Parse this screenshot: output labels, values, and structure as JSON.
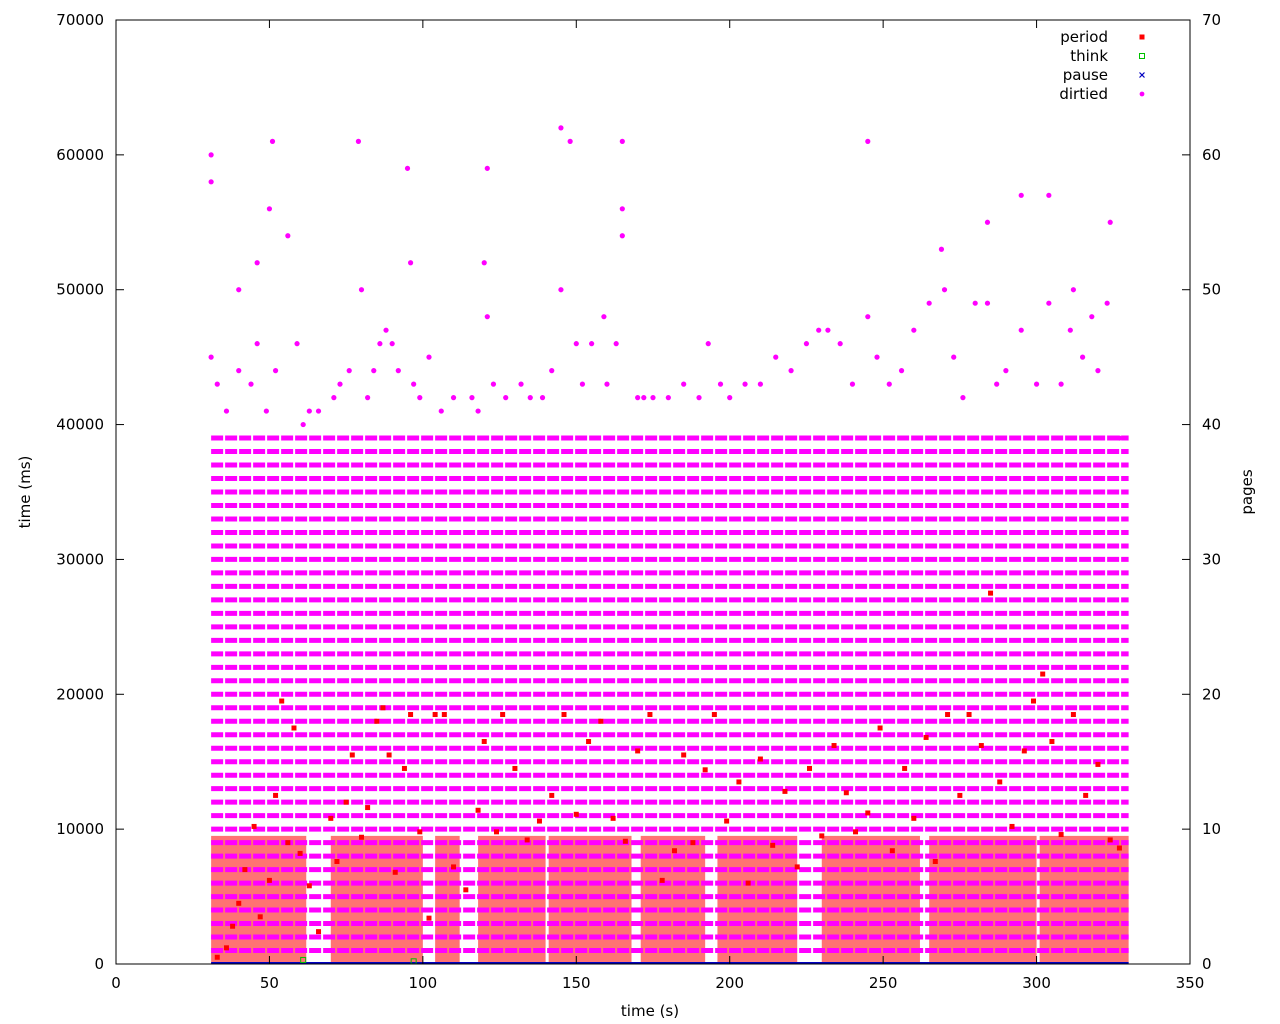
{
  "chart_data": {
    "type": "scatter",
    "title": "",
    "xlabel": "time (s)",
    "ylabel": "time (ms)",
    "y2label": "pages",
    "xlim": [
      0,
      350
    ],
    "ylim": [
      0,
      70000
    ],
    "y2lim": [
      0,
      70
    ],
    "xticks": [
      0,
      50,
      100,
      150,
      200,
      250,
      300,
      350
    ],
    "yticks": [
      0,
      10000,
      20000,
      30000,
      40000,
      50000,
      60000,
      70000
    ],
    "y2ticks": [
      0,
      10,
      20,
      30,
      40,
      50,
      60,
      70
    ],
    "grid": false,
    "legend_position": "top-right",
    "series": [
      {
        "name": "period",
        "axis": "y",
        "color": "#ff0000",
        "marker": "filled-square",
        "points": [
          [
            33,
            500
          ],
          [
            36,
            1200
          ],
          [
            38,
            2800
          ],
          [
            40,
            4500
          ],
          [
            42,
            7000
          ],
          [
            45,
            10200
          ],
          [
            47,
            3500
          ],
          [
            50,
            6200
          ],
          [
            52,
            12500
          ],
          [
            54,
            19500
          ],
          [
            56,
            9000
          ],
          [
            58,
            17500
          ],
          [
            60,
            8200
          ],
          [
            63,
            5800
          ],
          [
            66,
            2400
          ],
          [
            70,
            10800
          ],
          [
            72,
            7600
          ],
          [
            75,
            12000
          ],
          [
            77,
            15500
          ],
          [
            80,
            9400
          ],
          [
            82,
            11600
          ],
          [
            85,
            18000
          ],
          [
            87,
            19000
          ],
          [
            89,
            15500
          ],
          [
            91,
            6800
          ],
          [
            94,
            14500
          ],
          [
            96,
            18500
          ],
          [
            99,
            9800
          ],
          [
            102,
            3400
          ],
          [
            104,
            18500
          ],
          [
            107,
            18500
          ],
          [
            110,
            7200
          ],
          [
            114,
            5500
          ],
          [
            118,
            11400
          ],
          [
            120,
            16500
          ],
          [
            124,
            9800
          ],
          [
            126,
            18500
          ],
          [
            130,
            14500
          ],
          [
            134,
            9200
          ],
          [
            138,
            10600
          ],
          [
            142,
            12500
          ],
          [
            146,
            18500
          ],
          [
            150,
            11100
          ],
          [
            154,
            16500
          ],
          [
            158,
            18000
          ],
          [
            162,
            10800
          ],
          [
            166,
            9100
          ],
          [
            170,
            15800
          ],
          [
            174,
            18500
          ],
          [
            178,
            6200
          ],
          [
            182,
            8400
          ],
          [
            185,
            15500
          ],
          [
            188,
            9000
          ],
          [
            192,
            14400
          ],
          [
            195,
            18500
          ],
          [
            199,
            10600
          ],
          [
            203,
            13500
          ],
          [
            206,
            6000
          ],
          [
            210,
            15200
          ],
          [
            214,
            8800
          ],
          [
            218,
            12800
          ],
          [
            222,
            7200
          ],
          [
            226,
            14500
          ],
          [
            230,
            9500
          ],
          [
            234,
            16200
          ],
          [
            238,
            12700
          ],
          [
            241,
            9800
          ],
          [
            245,
            11200
          ],
          [
            249,
            17500
          ],
          [
            253,
            8400
          ],
          [
            257,
            14500
          ],
          [
            260,
            10800
          ],
          [
            264,
            16800
          ],
          [
            267,
            7600
          ],
          [
            271,
            18500
          ],
          [
            275,
            12500
          ],
          [
            278,
            18500
          ],
          [
            282,
            16200
          ],
          [
            285,
            27500
          ],
          [
            288,
            13500
          ],
          [
            292,
            10200
          ],
          [
            296,
            15800
          ],
          [
            299,
            19500
          ],
          [
            302,
            21500
          ],
          [
            305,
            16500
          ],
          [
            308,
            9600
          ],
          [
            312,
            18500
          ],
          [
            316,
            12500
          ],
          [
            320,
            14800
          ],
          [
            324,
            9200
          ],
          [
            327,
            8600
          ]
        ]
      },
      {
        "name": "think",
        "axis": "y",
        "color": "#00c000",
        "marker": "open-square",
        "points": [
          [
            61,
            300
          ],
          [
            97,
            200
          ]
        ]
      },
      {
        "name": "pause",
        "axis": "y",
        "color": "#0000c0",
        "marker": "cross",
        "points": [
          [
            31,
            0
          ],
          [
            330,
            0
          ]
        ]
      },
      {
        "name": "dirtied",
        "axis": "y2",
        "color": "#ff00ff",
        "marker": "circle",
        "points": [
          [
            31,
            60
          ],
          [
            31,
            58
          ],
          [
            31,
            45
          ],
          [
            33,
            43
          ],
          [
            36,
            41
          ],
          [
            40,
            50
          ],
          [
            40,
            44
          ],
          [
            44,
            43
          ],
          [
            46,
            52
          ],
          [
            46,
            46
          ],
          [
            49,
            41
          ],
          [
            50,
            56
          ],
          [
            51,
            61
          ],
          [
            52,
            44
          ],
          [
            56,
            54
          ],
          [
            59,
            46
          ],
          [
            61,
            40
          ],
          [
            63,
            41
          ],
          [
            66,
            41
          ],
          [
            71,
            42
          ],
          [
            73,
            43
          ],
          [
            76,
            44
          ],
          [
            79,
            61
          ],
          [
            80,
            50
          ],
          [
            82,
            42
          ],
          [
            84,
            44
          ],
          [
            86,
            46
          ],
          [
            88,
            47
          ],
          [
            90,
            46
          ],
          [
            92,
            44
          ],
          [
            95,
            59
          ],
          [
            96,
            52
          ],
          [
            97,
            43
          ],
          [
            99,
            42
          ],
          [
            102,
            45
          ],
          [
            106,
            41
          ],
          [
            110,
            42
          ],
          [
            116,
            42
          ],
          [
            118,
            41
          ],
          [
            120,
            52
          ],
          [
            121,
            59
          ],
          [
            121,
            48
          ],
          [
            123,
            43
          ],
          [
            127,
            42
          ],
          [
            132,
            43
          ],
          [
            135,
            42
          ],
          [
            139,
            42
          ],
          [
            142,
            44
          ],
          [
            145,
            62
          ],
          [
            145,
            50
          ],
          [
            148,
            61
          ],
          [
            150,
            46
          ],
          [
            152,
            43
          ],
          [
            155,
            46
          ],
          [
            159,
            48
          ],
          [
            160,
            43
          ],
          [
            163,
            46
          ],
          [
            165,
            61
          ],
          [
            165,
            56
          ],
          [
            165,
            54
          ],
          [
            170,
            42
          ],
          [
            172,
            42
          ],
          [
            175,
            42
          ],
          [
            180,
            42
          ],
          [
            185,
            43
          ],
          [
            190,
            42
          ],
          [
            193,
            46
          ],
          [
            197,
            43
          ],
          [
            200,
            42
          ],
          [
            205,
            43
          ],
          [
            210,
            43
          ],
          [
            215,
            45
          ],
          [
            220,
            44
          ],
          [
            225,
            46
          ],
          [
            229,
            47
          ],
          [
            232,
            47
          ],
          [
            236,
            46
          ],
          [
            240,
            43
          ],
          [
            245,
            61
          ],
          [
            245,
            48
          ],
          [
            248,
            45
          ],
          [
            252,
            43
          ],
          [
            256,
            44
          ],
          [
            260,
            47
          ],
          [
            265,
            49
          ],
          [
            269,
            53
          ],
          [
            270,
            50
          ],
          [
            273,
            45
          ],
          [
            276,
            42
          ],
          [
            280,
            49
          ],
          [
            284,
            55
          ],
          [
            284,
            49
          ],
          [
            287,
            43
          ],
          [
            290,
            44
          ],
          [
            295,
            57
          ],
          [
            295,
            47
          ],
          [
            300,
            43
          ],
          [
            304,
            57
          ],
          [
            304,
            49
          ],
          [
            308,
            43
          ],
          [
            311,
            47
          ],
          [
            312,
            50
          ],
          [
            315,
            45
          ],
          [
            318,
            48
          ],
          [
            320,
            44
          ],
          [
            323,
            49
          ],
          [
            324,
            55
          ],
          [
            327,
            39
          ]
        ]
      }
    ],
    "dense_bands": {
      "dirtied_levels": [
        1,
        2,
        3,
        4,
        5,
        6,
        7,
        8,
        9,
        10,
        11,
        12,
        13,
        14,
        15,
        16,
        17,
        18,
        19,
        20,
        21,
        22,
        23,
        24,
        25,
        26,
        27,
        28,
        29,
        30,
        31,
        32,
        33,
        34,
        35,
        36,
        37,
        38,
        39
      ],
      "x_range": [
        31,
        330
      ],
      "period_clusters": [
        [
          31,
          62
        ],
        [
          70,
          100
        ],
        [
          104,
          112
        ],
        [
          118,
          140
        ],
        [
          141,
          168
        ],
        [
          171,
          192
        ],
        [
          196,
          222
        ],
        [
          230,
          262
        ],
        [
          265,
          300
        ],
        [
          301,
          330
        ]
      ]
    }
  }
}
